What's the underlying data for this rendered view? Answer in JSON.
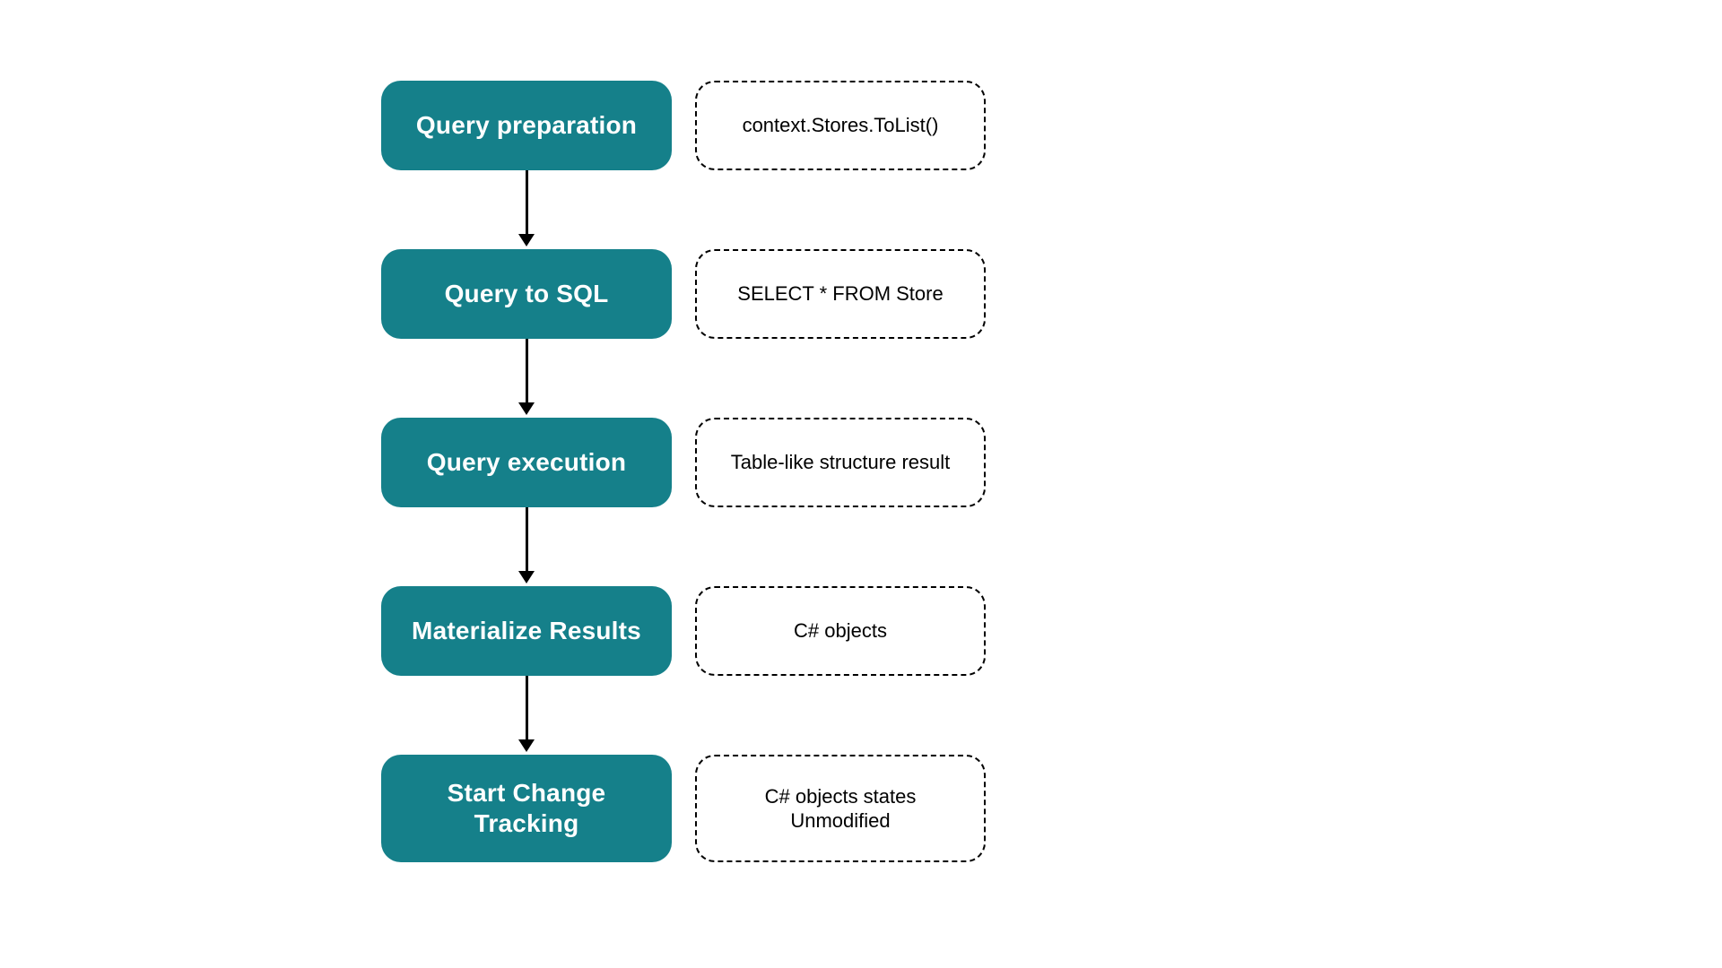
{
  "colors": {
    "step_bg": "#15808a",
    "step_text": "#ffffff",
    "detail_border": "#000000",
    "detail_text": "#000000"
  },
  "diagram": {
    "steps": [
      {
        "label": "Query preparation",
        "detail": "context.Stores.ToList()"
      },
      {
        "label": "Query to SQL",
        "detail": "SELECT * FROM Store"
      },
      {
        "label": "Query execution",
        "detail": "Table-like structure result"
      },
      {
        "label": "Materialize Results",
        "detail": "C# objects"
      },
      {
        "label": "Start Change\nTracking",
        "detail": "C# objects states\nUnmodified"
      }
    ]
  }
}
